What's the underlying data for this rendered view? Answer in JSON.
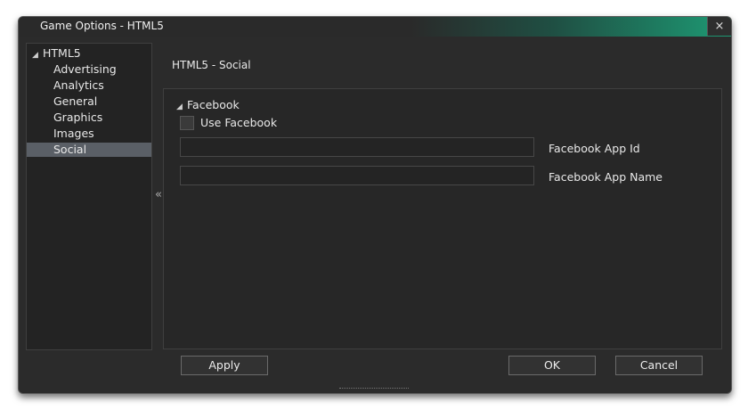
{
  "window": {
    "title": "Game Options - HTML5",
    "close_glyph": "×"
  },
  "tree": {
    "root_label": "HTML5",
    "root_toggle": "◢",
    "items": [
      {
        "label": "Advertising"
      },
      {
        "label": "Analytics"
      },
      {
        "label": "General"
      },
      {
        "label": "Graphics"
      },
      {
        "label": "Images"
      },
      {
        "label": "Social",
        "selected": true
      }
    ],
    "collapse_glyph": "«"
  },
  "main": {
    "section_title": "HTML5 - Social",
    "group": {
      "toggle": "◢",
      "title": "Facebook",
      "checkbox_label": "Use Facebook",
      "checkbox_checked": false,
      "app_id_label": "Facebook App Id",
      "app_id_value": "",
      "app_name_label": "Facebook App Name",
      "app_name_value": ""
    }
  },
  "buttons": {
    "apply": "Apply",
    "ok": "OK",
    "cancel": "Cancel"
  },
  "colors": {
    "accent": "#1e9a74",
    "selection": "#5a5f66",
    "background": "#2b2b2b"
  }
}
